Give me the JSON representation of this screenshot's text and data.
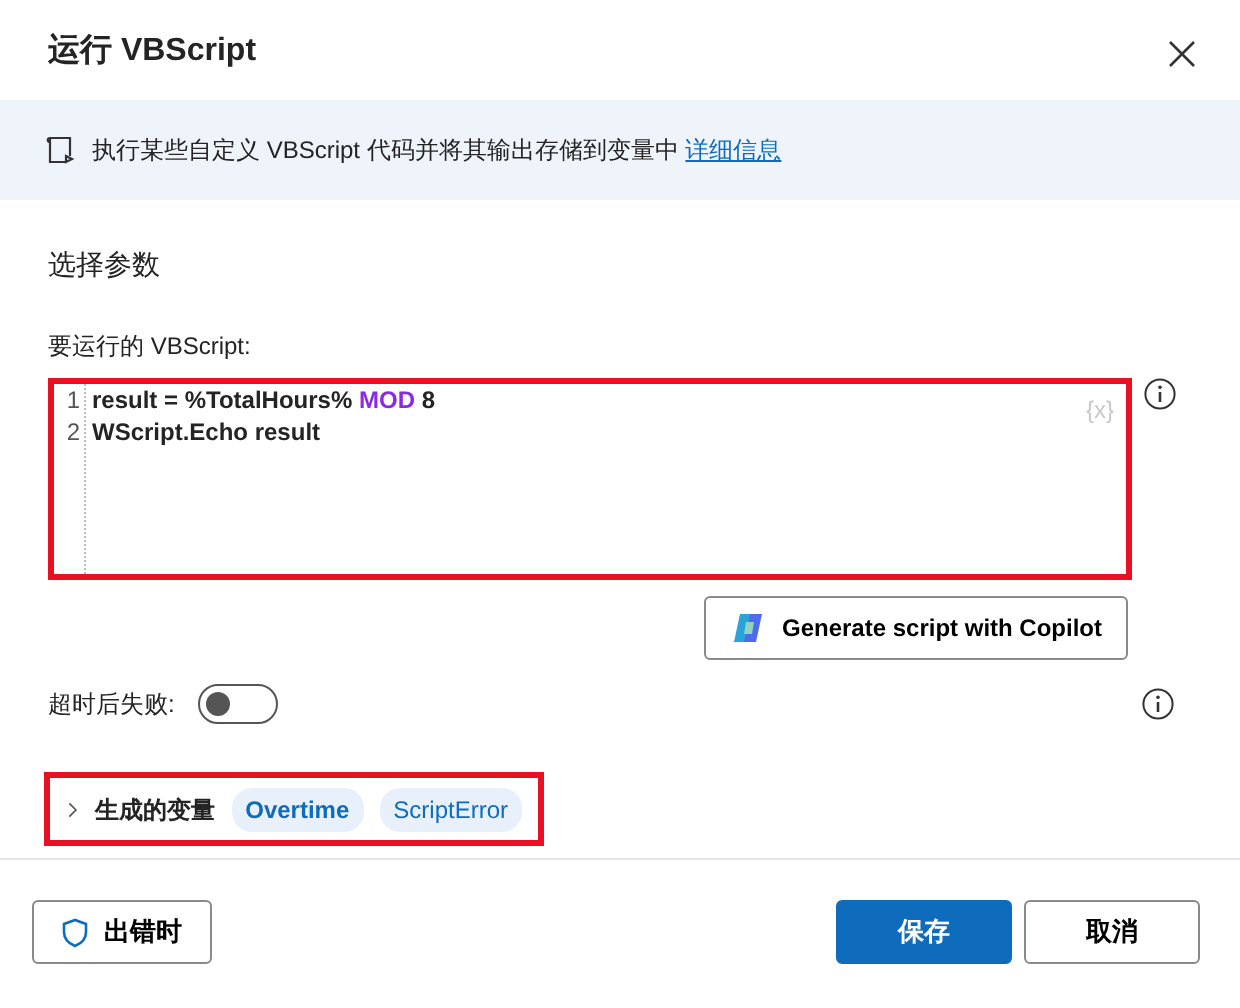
{
  "window": {
    "title": "运行 VBScript"
  },
  "banner": {
    "text": "执行某些自定义 VBScript 代码并将其输出存储到变量中",
    "link": "详细信息"
  },
  "section_title": "选择参数",
  "script_field": {
    "label": "要运行的 VBScript:",
    "highlighted": true,
    "variable_hint": "{x}",
    "lines": [
      {
        "number": "1",
        "tokens": [
          {
            "kind": "plain",
            "text": "result = %TotalHours% "
          },
          {
            "kind": "keyword",
            "text": "MOD"
          },
          {
            "kind": "plain",
            "text": " 8"
          }
        ]
      },
      {
        "number": "2",
        "tokens": [
          {
            "kind": "plain",
            "text": "WScript.Echo result"
          }
        ]
      }
    ]
  },
  "copilot_button": "Generate script with Copilot",
  "timeout_toggle": {
    "label": "超时后失败:",
    "on": false
  },
  "variables": {
    "label": "生成的变量",
    "expanded": false,
    "highlighted": true,
    "items": [
      {
        "name": "Overtime",
        "emphasized": true
      },
      {
        "name": "ScriptError",
        "emphasized": false
      }
    ]
  },
  "footer": {
    "on_error": "出错时",
    "save": "保存",
    "cancel": "取消"
  }
}
